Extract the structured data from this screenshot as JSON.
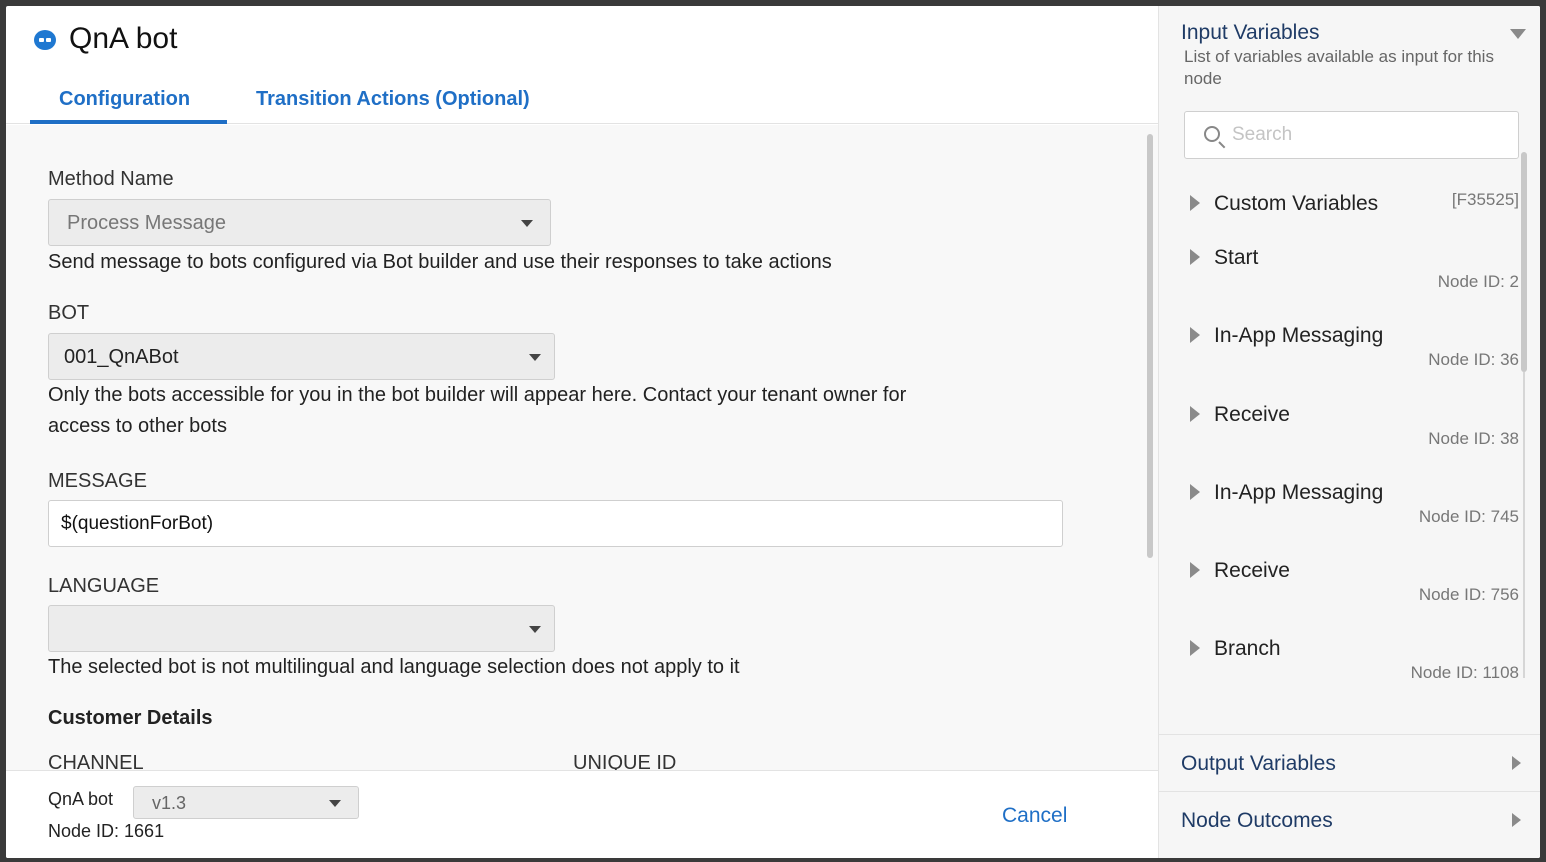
{
  "header": {
    "title": "QnA bot",
    "tabs": [
      {
        "label": "Configuration",
        "active": true
      },
      {
        "label": "Transition Actions (Optional)",
        "active": false
      }
    ]
  },
  "form": {
    "method_label": "Method Name",
    "method_value": "Process Message",
    "method_help": "Send message to bots configured via Bot builder and use their responses to take actions",
    "bot_label": "BOT",
    "bot_value": "001_QnABot",
    "bot_help_line1": "Only the bots accessible for you in the bot builder will appear here. Contact your tenant owner for",
    "bot_help_line2": "access to other bots",
    "message_label": "MESSAGE",
    "message_value": "$(questionForBot)",
    "language_label": "LANGUAGE",
    "language_value": "",
    "language_help": "The selected bot is not multilingual and language selection does not apply to it",
    "customer_details_heading": "Customer Details",
    "channel_label": "CHANNEL",
    "unique_id_label": "UNIQUE ID"
  },
  "footer": {
    "node_name": "QnA bot",
    "version_value": "v1.3",
    "node_id": "Node ID: 1661",
    "cancel_label": "Cancel"
  },
  "sidebar": {
    "input_variables_title": "Input Variables",
    "input_variables_desc": "List of variables available as input for this node",
    "search_placeholder": "Search",
    "items": [
      {
        "name": "Custom Variables",
        "tag": "[F35525]",
        "node_id": ""
      },
      {
        "name": "Start",
        "tag": "",
        "node_id": "Node ID: 2"
      },
      {
        "name": "In-App Messaging",
        "tag": "",
        "node_id": "Node ID: 36"
      },
      {
        "name": "Receive",
        "tag": "",
        "node_id": "Node ID: 38"
      },
      {
        "name": "In-App Messaging",
        "tag": "",
        "node_id": "Node ID: 745"
      },
      {
        "name": "Receive",
        "tag": "",
        "node_id": "Node ID: 756"
      },
      {
        "name": "Branch",
        "tag": "",
        "node_id": "Node ID: 1108"
      }
    ],
    "output_variables_title": "Output Variables",
    "node_outcomes_title": "Node Outcomes"
  },
  "colors": {
    "accent": "#1f6fc6",
    "sidebar_heading": "#1f3b66"
  }
}
